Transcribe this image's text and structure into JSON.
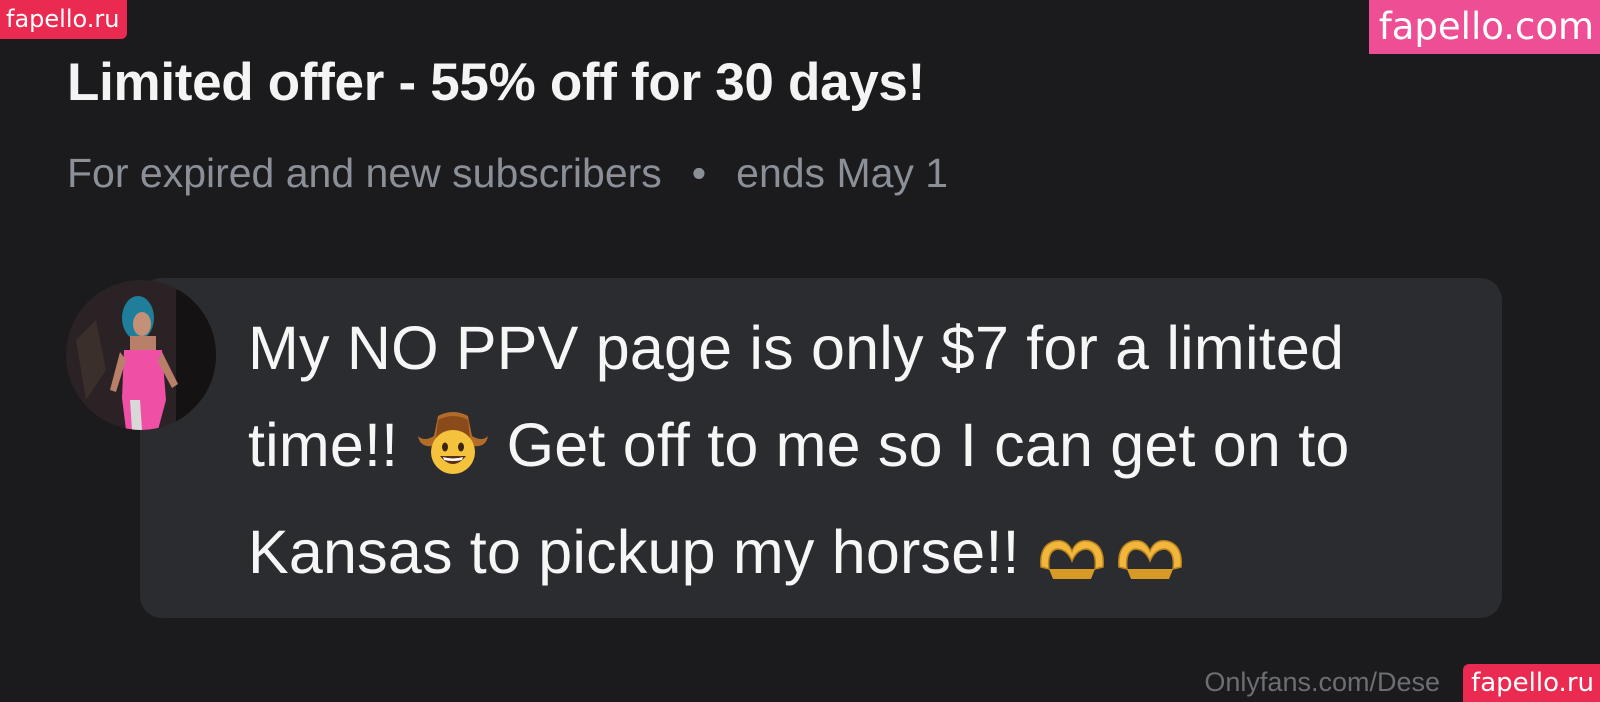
{
  "watermarks": {
    "top_left": "fapello.ru",
    "top_right": "fapello.com",
    "bottom_right": "fapello.ru"
  },
  "offer": {
    "title": "Limited offer - 55% off for 30 days!",
    "audience": "For expired and new subscribers",
    "separator": "•",
    "ends": "ends May 1"
  },
  "message": {
    "line1": "My NO PPV page is only $7 for a limited",
    "line2a": "time!!",
    "line2b": "Get off to me so I can get on to",
    "line3": "Kansas to pickup my horse!!",
    "emoji_cowboy": "cowboy-face-emoji",
    "emoji_hearts": "heart-hands-emoji"
  },
  "footer": {
    "url": "Onlyfans.com/Dese"
  },
  "colors": {
    "background": "#1b1b1d",
    "bubble": "#2a2c2f",
    "watermark_red": "#ea2a50",
    "watermark_pink": "#ee4e93",
    "muted_text": "#8a8f98"
  }
}
